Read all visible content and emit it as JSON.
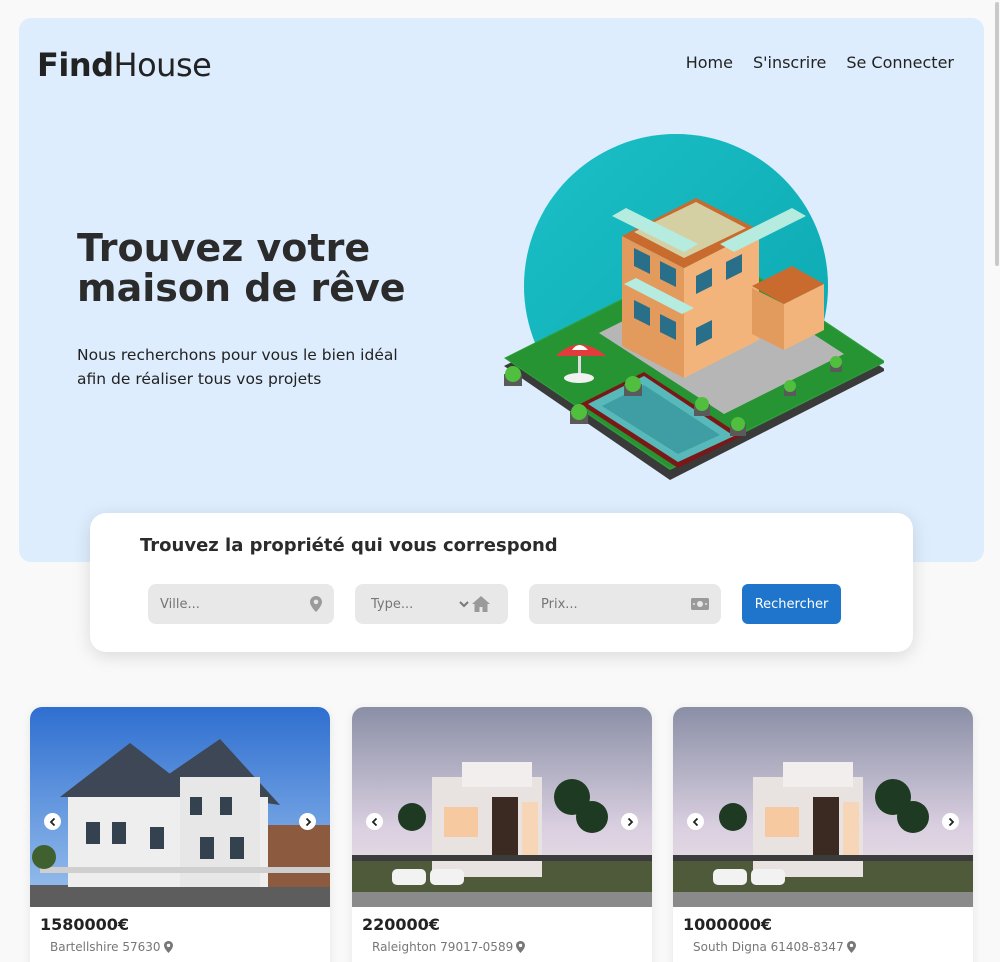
{
  "brand": {
    "bold": "Find",
    "regular": "House"
  },
  "nav": [
    {
      "label": "Home"
    },
    {
      "label": "S'inscrire"
    },
    {
      "label": "Se Connecter"
    }
  ],
  "hero": {
    "title": "Trouvez votre maison de rêve",
    "subtitle": "Nous recherchons pour vous le bien idéal afin de réaliser tous vos projets"
  },
  "search": {
    "title": "Trouvez la propriété qui vous correspond",
    "city_placeholder": "Ville...",
    "type_selected": "Type...",
    "price_placeholder": "Prix...",
    "button_label": "Rechercher"
  },
  "listings": [
    {
      "price": "1580000€",
      "address": "Bartellshire 57630"
    },
    {
      "price": "220000€",
      "address": "Raleighton 79017-0589"
    },
    {
      "price": "1000000€",
      "address": "South Digna 61408-8347"
    }
  ],
  "colors": {
    "hero_bg": "#deedfe",
    "accent": "#1f75cb",
    "page_bg": "#f9f9f9"
  },
  "icons": [
    "map-pin-icon",
    "home-icon",
    "money-icon",
    "chevron-down-icon",
    "chevron-left-icon",
    "chevron-right-icon"
  ]
}
